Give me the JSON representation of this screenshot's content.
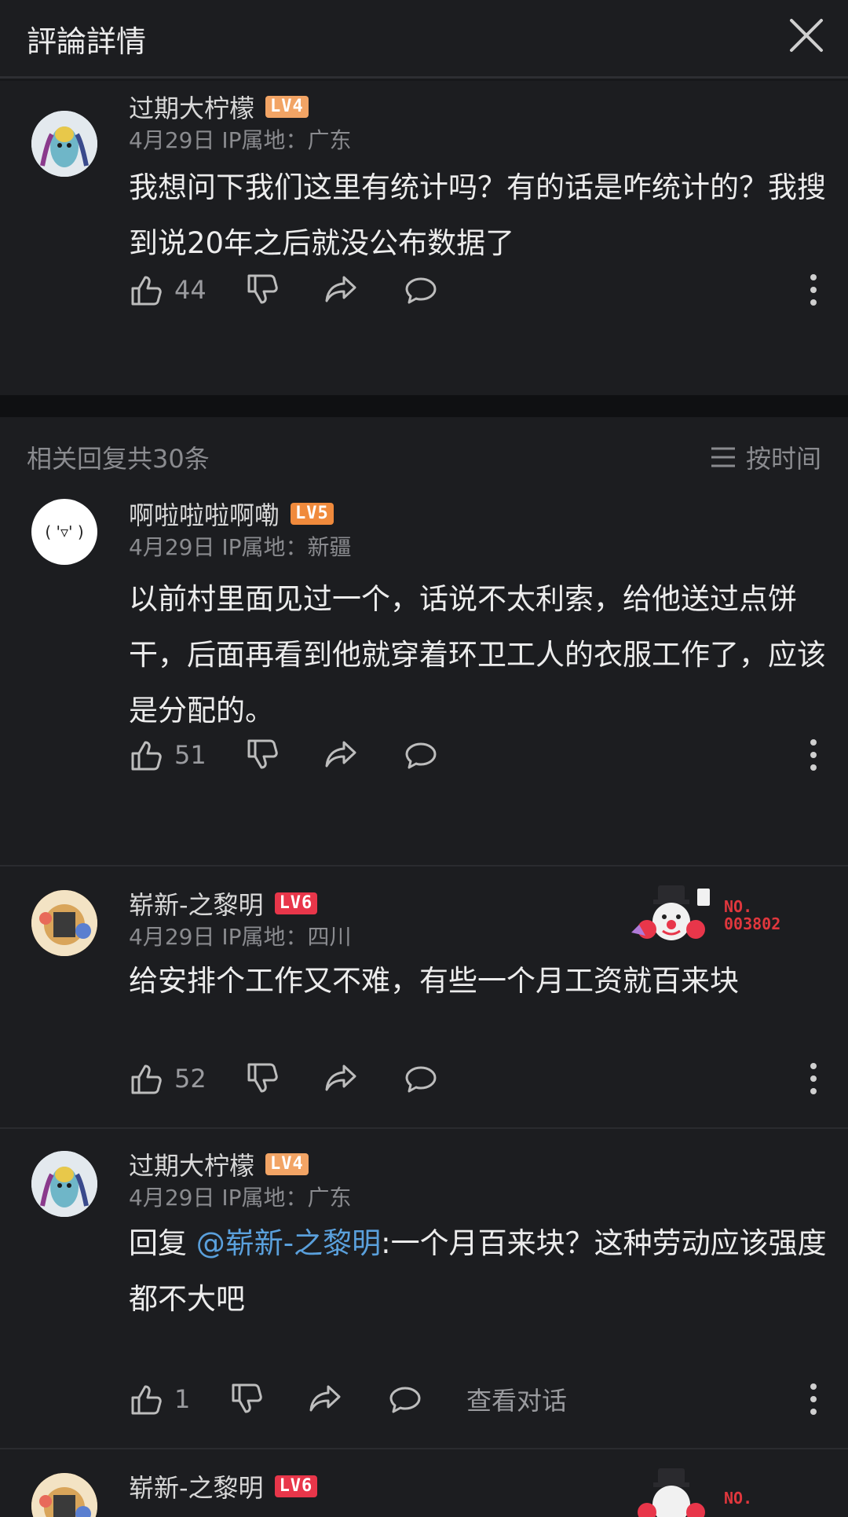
{
  "header": {
    "title": "評論詳情",
    "close_icon": "close-icon"
  },
  "main_comment": {
    "username": "过期大柠檬",
    "level": "LV4",
    "meta": "4月29日 IP属地：广东",
    "text": "我想问下我们这里有统计吗？有的话是咋统计的？我搜到说20年之后就没公布数据了",
    "likes": "44"
  },
  "replies_header": {
    "count_label": "相关回复共30条",
    "sort_label": "按时间"
  },
  "replies": [
    {
      "username": "啊啦啦啦啊嘞",
      "level": "LV5",
      "meta": "4月29日 IP属地：新疆",
      "text": "以前村里面见过一个，话说不太利索，给他送过点饼干，后面再看到他就穿着环卫工人的衣服工作了，应该是分配的。",
      "likes": "51",
      "avatar_text": "( '▿' )"
    },
    {
      "username": "崭新-之黎明",
      "level": "LV6",
      "meta": "4月29日 IP属地：四川",
      "text": "给安排个工作又不难，有些一个月工资就百来块",
      "likes": "52",
      "badge_no_line1": "NO.",
      "badge_no_line2": "003802"
    },
    {
      "username": "过期大柠檬",
      "level": "LV4",
      "meta": "4月29日 IP属地：广东",
      "reply_prefix": "回复 ",
      "mention": "@崭新-之黎明",
      "text": ":一个月百来块？这种劳动应该强度都不大吧",
      "likes": "1",
      "view_conversation": "查看对话"
    },
    {
      "username": "崭新-之黎明",
      "level": "LV6",
      "badge_no_line1": "NO."
    }
  ],
  "colors": {
    "lv4": "#f2a465",
    "lv5": "#f08a3c",
    "lv6": "#e8364a",
    "mention": "#5aa0dc"
  }
}
